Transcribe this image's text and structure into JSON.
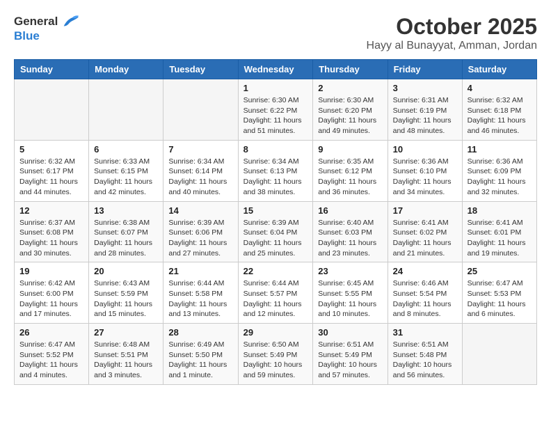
{
  "header": {
    "logo_general": "General",
    "logo_blue": "Blue",
    "month": "October 2025",
    "location": "Hayy al Bunayyat, Amman, Jordan"
  },
  "weekdays": [
    "Sunday",
    "Monday",
    "Tuesday",
    "Wednesday",
    "Thursday",
    "Friday",
    "Saturday"
  ],
  "weeks": [
    [
      {
        "day": "",
        "info": ""
      },
      {
        "day": "",
        "info": ""
      },
      {
        "day": "",
        "info": ""
      },
      {
        "day": "1",
        "sunrise": "Sunrise: 6:30 AM",
        "sunset": "Sunset: 6:22 PM",
        "daylight": "Daylight: 11 hours and 51 minutes."
      },
      {
        "day": "2",
        "sunrise": "Sunrise: 6:30 AM",
        "sunset": "Sunset: 6:20 PM",
        "daylight": "Daylight: 11 hours and 49 minutes."
      },
      {
        "day": "3",
        "sunrise": "Sunrise: 6:31 AM",
        "sunset": "Sunset: 6:19 PM",
        "daylight": "Daylight: 11 hours and 48 minutes."
      },
      {
        "day": "4",
        "sunrise": "Sunrise: 6:32 AM",
        "sunset": "Sunset: 6:18 PM",
        "daylight": "Daylight: 11 hours and 46 minutes."
      }
    ],
    [
      {
        "day": "5",
        "sunrise": "Sunrise: 6:32 AM",
        "sunset": "Sunset: 6:17 PM",
        "daylight": "Daylight: 11 hours and 44 minutes."
      },
      {
        "day": "6",
        "sunrise": "Sunrise: 6:33 AM",
        "sunset": "Sunset: 6:15 PM",
        "daylight": "Daylight: 11 hours and 42 minutes."
      },
      {
        "day": "7",
        "sunrise": "Sunrise: 6:34 AM",
        "sunset": "Sunset: 6:14 PM",
        "daylight": "Daylight: 11 hours and 40 minutes."
      },
      {
        "day": "8",
        "sunrise": "Sunrise: 6:34 AM",
        "sunset": "Sunset: 6:13 PM",
        "daylight": "Daylight: 11 hours and 38 minutes."
      },
      {
        "day": "9",
        "sunrise": "Sunrise: 6:35 AM",
        "sunset": "Sunset: 6:12 PM",
        "daylight": "Daylight: 11 hours and 36 minutes."
      },
      {
        "day": "10",
        "sunrise": "Sunrise: 6:36 AM",
        "sunset": "Sunset: 6:10 PM",
        "daylight": "Daylight: 11 hours and 34 minutes."
      },
      {
        "day": "11",
        "sunrise": "Sunrise: 6:36 AM",
        "sunset": "Sunset: 6:09 PM",
        "daylight": "Daylight: 11 hours and 32 minutes."
      }
    ],
    [
      {
        "day": "12",
        "sunrise": "Sunrise: 6:37 AM",
        "sunset": "Sunset: 6:08 PM",
        "daylight": "Daylight: 11 hours and 30 minutes."
      },
      {
        "day": "13",
        "sunrise": "Sunrise: 6:38 AM",
        "sunset": "Sunset: 6:07 PM",
        "daylight": "Daylight: 11 hours and 28 minutes."
      },
      {
        "day": "14",
        "sunrise": "Sunrise: 6:39 AM",
        "sunset": "Sunset: 6:06 PM",
        "daylight": "Daylight: 11 hours and 27 minutes."
      },
      {
        "day": "15",
        "sunrise": "Sunrise: 6:39 AM",
        "sunset": "Sunset: 6:04 PM",
        "daylight": "Daylight: 11 hours and 25 minutes."
      },
      {
        "day": "16",
        "sunrise": "Sunrise: 6:40 AM",
        "sunset": "Sunset: 6:03 PM",
        "daylight": "Daylight: 11 hours and 23 minutes."
      },
      {
        "day": "17",
        "sunrise": "Sunrise: 6:41 AM",
        "sunset": "Sunset: 6:02 PM",
        "daylight": "Daylight: 11 hours and 21 minutes."
      },
      {
        "day": "18",
        "sunrise": "Sunrise: 6:41 AM",
        "sunset": "Sunset: 6:01 PM",
        "daylight": "Daylight: 11 hours and 19 minutes."
      }
    ],
    [
      {
        "day": "19",
        "sunrise": "Sunrise: 6:42 AM",
        "sunset": "Sunset: 6:00 PM",
        "daylight": "Daylight: 11 hours and 17 minutes."
      },
      {
        "day": "20",
        "sunrise": "Sunrise: 6:43 AM",
        "sunset": "Sunset: 5:59 PM",
        "daylight": "Daylight: 11 hours and 15 minutes."
      },
      {
        "day": "21",
        "sunrise": "Sunrise: 6:44 AM",
        "sunset": "Sunset: 5:58 PM",
        "daylight": "Daylight: 11 hours and 13 minutes."
      },
      {
        "day": "22",
        "sunrise": "Sunrise: 6:44 AM",
        "sunset": "Sunset: 5:57 PM",
        "daylight": "Daylight: 11 hours and 12 minutes."
      },
      {
        "day": "23",
        "sunrise": "Sunrise: 6:45 AM",
        "sunset": "Sunset: 5:55 PM",
        "daylight": "Daylight: 11 hours and 10 minutes."
      },
      {
        "day": "24",
        "sunrise": "Sunrise: 6:46 AM",
        "sunset": "Sunset: 5:54 PM",
        "daylight": "Daylight: 11 hours and 8 minutes."
      },
      {
        "day": "25",
        "sunrise": "Sunrise: 6:47 AM",
        "sunset": "Sunset: 5:53 PM",
        "daylight": "Daylight: 11 hours and 6 minutes."
      }
    ],
    [
      {
        "day": "26",
        "sunrise": "Sunrise: 6:47 AM",
        "sunset": "Sunset: 5:52 PM",
        "daylight": "Daylight: 11 hours and 4 minutes."
      },
      {
        "day": "27",
        "sunrise": "Sunrise: 6:48 AM",
        "sunset": "Sunset: 5:51 PM",
        "daylight": "Daylight: 11 hours and 3 minutes."
      },
      {
        "day": "28",
        "sunrise": "Sunrise: 6:49 AM",
        "sunset": "Sunset: 5:50 PM",
        "daylight": "Daylight: 11 hours and 1 minute."
      },
      {
        "day": "29",
        "sunrise": "Sunrise: 6:50 AM",
        "sunset": "Sunset: 5:49 PM",
        "daylight": "Daylight: 10 hours and 59 minutes."
      },
      {
        "day": "30",
        "sunrise": "Sunrise: 6:51 AM",
        "sunset": "Sunset: 5:49 PM",
        "daylight": "Daylight: 10 hours and 57 minutes."
      },
      {
        "day": "31",
        "sunrise": "Sunrise: 6:51 AM",
        "sunset": "Sunset: 5:48 PM",
        "daylight": "Daylight: 10 hours and 56 minutes."
      },
      {
        "day": "",
        "info": ""
      }
    ]
  ]
}
